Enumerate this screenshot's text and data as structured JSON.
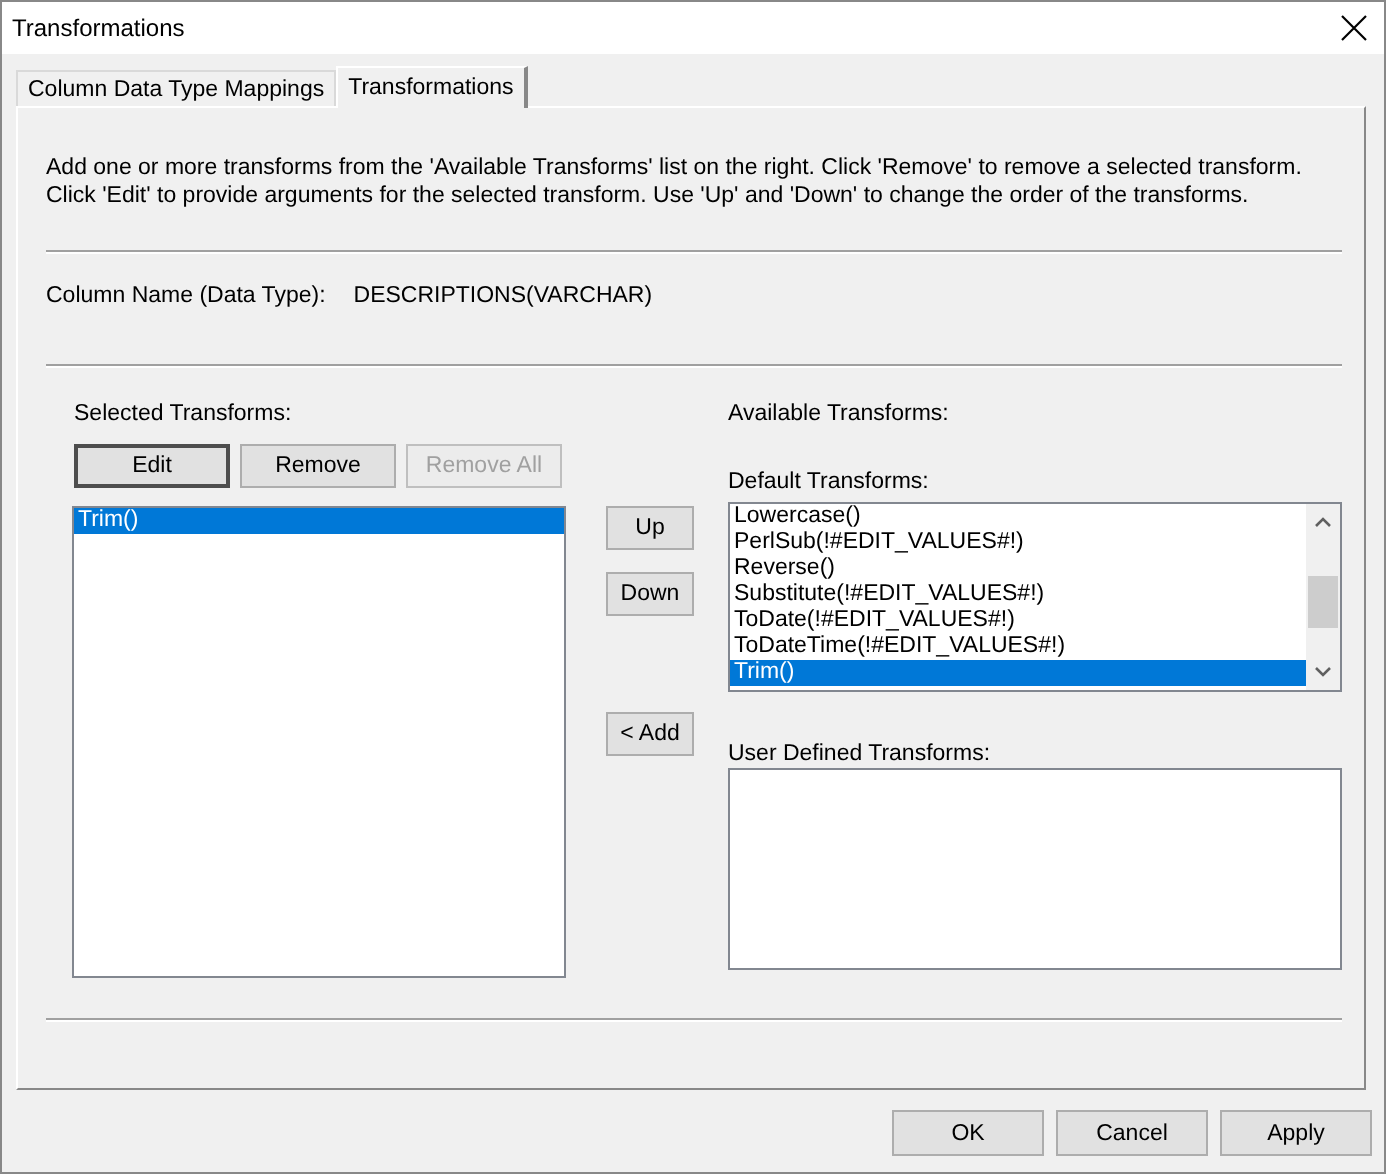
{
  "window": {
    "title": "Transformations"
  },
  "tabs": [
    {
      "label": "Column Data Type Mappings",
      "selected": false
    },
    {
      "label": "Transformations",
      "selected": true
    }
  ],
  "description": "Add one or more transforms from the 'Available Transforms' list on the right. Click 'Remove' to remove a selected transform. Click 'Edit' to provide arguments for the selected transform. Use 'Up' and 'Down' to change the order of the transforms.",
  "column_name": {
    "label": "Column Name (Data Type):",
    "value": "DESCRIPTIONS(VARCHAR)"
  },
  "selected_transforms": {
    "label": "Selected Transforms:",
    "buttons": [
      {
        "label": "Edit",
        "default": true,
        "disabled": false
      },
      {
        "label": "Remove",
        "default": false,
        "disabled": false
      },
      {
        "label": "Remove All",
        "default": false,
        "disabled": true
      }
    ],
    "items": [
      {
        "label": "Trim()",
        "selected": true
      }
    ]
  },
  "order_buttons": [
    "Up",
    "Down"
  ],
  "add_button": "< Add",
  "available_transforms": {
    "label": "Available Transforms:",
    "default_transforms": {
      "label": "Default Transforms:",
      "items": [
        {
          "label": "Lowercase()",
          "selected": false
        },
        {
          "label": "PerlSub(!#EDIT_VALUES#!)",
          "selected": false
        },
        {
          "label": "Reverse()",
          "selected": false
        },
        {
          "label": "Substitute(!#EDIT_VALUES#!)",
          "selected": false
        },
        {
          "label": "ToDate(!#EDIT_VALUES#!)",
          "selected": false
        },
        {
          "label": "ToDateTime(!#EDIT_VALUES#!)",
          "selected": false
        },
        {
          "label": "Trim()",
          "selected": true
        }
      ]
    },
    "user_defined_transforms": {
      "label": "User Defined Transforms:"
    }
  },
  "dialog_buttons": [
    "OK",
    "Cancel",
    "Apply"
  ]
}
